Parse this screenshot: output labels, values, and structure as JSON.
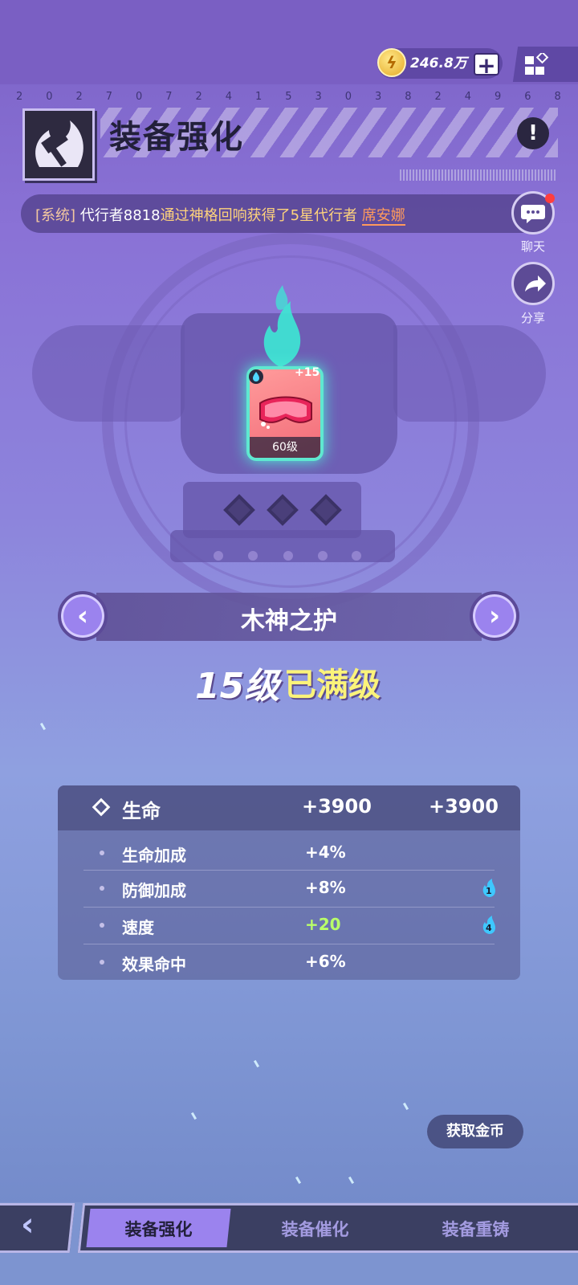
{
  "currency": {
    "icon": "lightning-coin-icon",
    "amount": "246.8万",
    "add_symbol": "+"
  },
  "serial_digits": [
    "2",
    "0",
    "2",
    "7",
    "0",
    "7",
    "2",
    "4",
    "1",
    "5",
    "3",
    "0",
    "3",
    "8",
    "2",
    "4",
    "9",
    "6",
    "8"
  ],
  "header": {
    "title": "装备强化",
    "alert_symbol": "!"
  },
  "system_message": {
    "tag": "[系统]",
    "player": "代行者8818",
    "message": "通过神格回响获得了5星代行者",
    "hero": "席安娜"
  },
  "side_buttons": {
    "chat_label": "聊天",
    "share_label": "分享"
  },
  "item": {
    "enhance": "+15",
    "level": "60级",
    "icon": "goggles-icon"
  },
  "equipment": {
    "name": "木神之护",
    "level": "15级",
    "status": "已满级",
    "prev_symbol": "‹",
    "next_symbol": "›"
  },
  "stats": {
    "main": {
      "label": "生命",
      "current": "+3900",
      "next": "+3900"
    },
    "rows": [
      {
        "label": "生命加成",
        "value": "+4%"
      },
      {
        "label": "防御加成",
        "value": "+8%",
        "badge": "1"
      },
      {
        "label": "速度",
        "value": "+20",
        "badge": "4"
      },
      {
        "label": "效果命中",
        "value": "+6%"
      }
    ]
  },
  "get_gold_button": "获取金币",
  "bottom_nav": {
    "back_symbol": "‹",
    "tabs": [
      "装备强化",
      "装备催化",
      "装备重铸"
    ],
    "active_tab": "装备强化"
  },
  "colors": {
    "accent": "#9b83ee",
    "max_level": "#fbf37a",
    "green_value": "#b9ff69",
    "item_glow": "#5fe8d0"
  }
}
